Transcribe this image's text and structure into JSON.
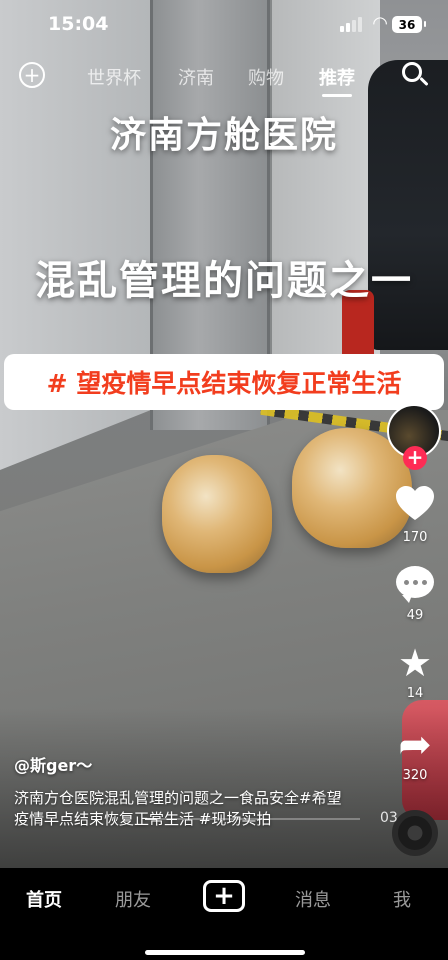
{
  "status_bar": {
    "time": "15:04",
    "battery": "36"
  },
  "top_nav": {
    "tabs": [
      {
        "label": "世界杯",
        "active": false
      },
      {
        "label": "济南",
        "active": false
      },
      {
        "label": "购物",
        "active": false
      },
      {
        "label": "推荐",
        "active": true
      }
    ],
    "icons": {
      "left": "plus-circle-icon",
      "right": "search-icon"
    }
  },
  "video": {
    "caption_title": "济南方舱医院",
    "caption_subtitle": "混乱管理的问题之一",
    "tag_banner": "# 望疫情早点结束恢复正常生活",
    "progress": 0.05,
    "duration_visible": "03"
  },
  "sidebar": {
    "follow_label": "+",
    "like_count": "170",
    "comment_count": "49",
    "favorite_count": "14",
    "share_count": "320"
  },
  "post": {
    "author": "@斯ger～",
    "description": "济南方仓医院混乱管理的问题之一食品安全#希望疫情早点结束恢复正常生活 #现场实拍"
  },
  "bottom_nav": {
    "items": [
      {
        "label": "首页",
        "active": true
      },
      {
        "label": "朋友",
        "active": false
      },
      {
        "label": "+",
        "active": false
      },
      {
        "label": "消息",
        "active": false
      },
      {
        "label": "我",
        "active": false
      }
    ]
  },
  "colors": {
    "accent_red": "#fe2c55",
    "tag_red": "#f23d1e"
  }
}
